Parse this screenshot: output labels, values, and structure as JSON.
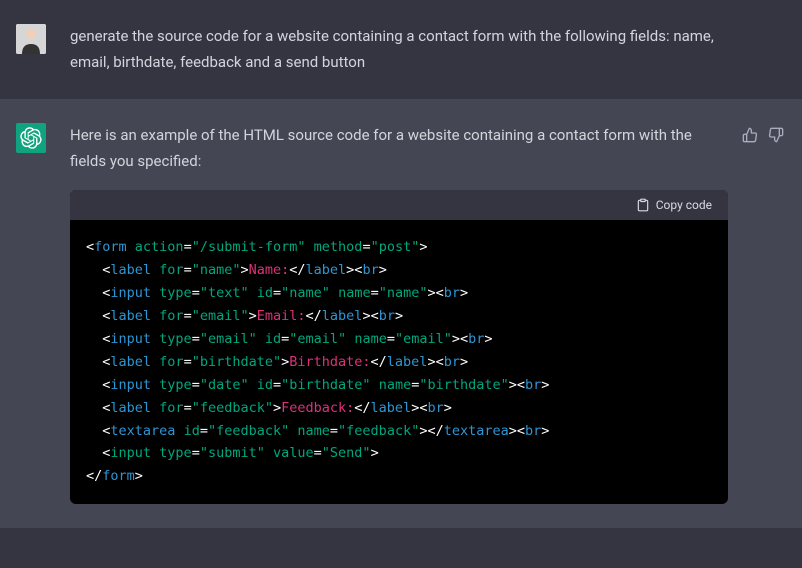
{
  "user": {
    "message": "generate the source code for a website containing a contact form with the following fields: name, email, birthdate, feedback and a send button"
  },
  "assistant": {
    "intro": "Here is an example of the HTML source code for a website containing a contact form with the fields you specified:",
    "copy_label": "Copy code",
    "code": {
      "tokens": [
        [
          {
            "t": "white",
            "v": "<"
          },
          {
            "t": "tag",
            "v": "form"
          },
          {
            "t": "white",
            "v": " "
          },
          {
            "t": "attr",
            "v": "action"
          },
          {
            "t": "white",
            "v": "="
          },
          {
            "t": "str",
            "v": "\"/submit-form\""
          },
          {
            "t": "white",
            "v": " "
          },
          {
            "t": "attr",
            "v": "method"
          },
          {
            "t": "white",
            "v": "="
          },
          {
            "t": "str",
            "v": "\"post\""
          },
          {
            "t": "white",
            "v": ">"
          }
        ],
        [
          {
            "t": "white",
            "v": "  <"
          },
          {
            "t": "tag",
            "v": "label"
          },
          {
            "t": "white",
            "v": " "
          },
          {
            "t": "attr",
            "v": "for"
          },
          {
            "t": "white",
            "v": "="
          },
          {
            "t": "str",
            "v": "\"name\""
          },
          {
            "t": "white",
            "v": ">"
          },
          {
            "t": "text",
            "v": "Name:"
          },
          {
            "t": "white",
            "v": "</"
          },
          {
            "t": "tag",
            "v": "label"
          },
          {
            "t": "white",
            "v": "><"
          },
          {
            "t": "tag",
            "v": "br"
          },
          {
            "t": "white",
            "v": ">"
          }
        ],
        [
          {
            "t": "white",
            "v": "  <"
          },
          {
            "t": "tag",
            "v": "input"
          },
          {
            "t": "white",
            "v": " "
          },
          {
            "t": "attr",
            "v": "type"
          },
          {
            "t": "white",
            "v": "="
          },
          {
            "t": "str",
            "v": "\"text\""
          },
          {
            "t": "white",
            "v": " "
          },
          {
            "t": "attr",
            "v": "id"
          },
          {
            "t": "white",
            "v": "="
          },
          {
            "t": "str",
            "v": "\"name\""
          },
          {
            "t": "white",
            "v": " "
          },
          {
            "t": "attr",
            "v": "name"
          },
          {
            "t": "white",
            "v": "="
          },
          {
            "t": "str",
            "v": "\"name\""
          },
          {
            "t": "white",
            "v": "><"
          },
          {
            "t": "tag",
            "v": "br"
          },
          {
            "t": "white",
            "v": ">"
          }
        ],
        [
          {
            "t": "white",
            "v": "  <"
          },
          {
            "t": "tag",
            "v": "label"
          },
          {
            "t": "white",
            "v": " "
          },
          {
            "t": "attr",
            "v": "for"
          },
          {
            "t": "white",
            "v": "="
          },
          {
            "t": "str",
            "v": "\"email\""
          },
          {
            "t": "white",
            "v": ">"
          },
          {
            "t": "text",
            "v": "Email:"
          },
          {
            "t": "white",
            "v": "</"
          },
          {
            "t": "tag",
            "v": "label"
          },
          {
            "t": "white",
            "v": "><"
          },
          {
            "t": "tag",
            "v": "br"
          },
          {
            "t": "white",
            "v": ">"
          }
        ],
        [
          {
            "t": "white",
            "v": "  <"
          },
          {
            "t": "tag",
            "v": "input"
          },
          {
            "t": "white",
            "v": " "
          },
          {
            "t": "attr",
            "v": "type"
          },
          {
            "t": "white",
            "v": "="
          },
          {
            "t": "str",
            "v": "\"email\""
          },
          {
            "t": "white",
            "v": " "
          },
          {
            "t": "attr",
            "v": "id"
          },
          {
            "t": "white",
            "v": "="
          },
          {
            "t": "str",
            "v": "\"email\""
          },
          {
            "t": "white",
            "v": " "
          },
          {
            "t": "attr",
            "v": "name"
          },
          {
            "t": "white",
            "v": "="
          },
          {
            "t": "str",
            "v": "\"email\""
          },
          {
            "t": "white",
            "v": "><"
          },
          {
            "t": "tag",
            "v": "br"
          },
          {
            "t": "white",
            "v": ">"
          }
        ],
        [
          {
            "t": "white",
            "v": "  <"
          },
          {
            "t": "tag",
            "v": "label"
          },
          {
            "t": "white",
            "v": " "
          },
          {
            "t": "attr",
            "v": "for"
          },
          {
            "t": "white",
            "v": "="
          },
          {
            "t": "str",
            "v": "\"birthdate\""
          },
          {
            "t": "white",
            "v": ">"
          },
          {
            "t": "text",
            "v": "Birthdate:"
          },
          {
            "t": "white",
            "v": "</"
          },
          {
            "t": "tag",
            "v": "label"
          },
          {
            "t": "white",
            "v": "><"
          },
          {
            "t": "tag",
            "v": "br"
          },
          {
            "t": "white",
            "v": ">"
          }
        ],
        [
          {
            "t": "white",
            "v": "  <"
          },
          {
            "t": "tag",
            "v": "input"
          },
          {
            "t": "white",
            "v": " "
          },
          {
            "t": "attr",
            "v": "type"
          },
          {
            "t": "white",
            "v": "="
          },
          {
            "t": "str",
            "v": "\"date\""
          },
          {
            "t": "white",
            "v": " "
          },
          {
            "t": "attr",
            "v": "id"
          },
          {
            "t": "white",
            "v": "="
          },
          {
            "t": "str",
            "v": "\"birthdate\""
          },
          {
            "t": "white",
            "v": " "
          },
          {
            "t": "attr",
            "v": "name"
          },
          {
            "t": "white",
            "v": "="
          },
          {
            "t": "str",
            "v": "\"birthdate\""
          },
          {
            "t": "white",
            "v": "><"
          },
          {
            "t": "tag",
            "v": "br"
          },
          {
            "t": "white",
            "v": ">"
          }
        ],
        [
          {
            "t": "white",
            "v": "  <"
          },
          {
            "t": "tag",
            "v": "label"
          },
          {
            "t": "white",
            "v": " "
          },
          {
            "t": "attr",
            "v": "for"
          },
          {
            "t": "white",
            "v": "="
          },
          {
            "t": "str",
            "v": "\"feedback\""
          },
          {
            "t": "white",
            "v": ">"
          },
          {
            "t": "text",
            "v": "Feedback:"
          },
          {
            "t": "white",
            "v": "</"
          },
          {
            "t": "tag",
            "v": "label"
          },
          {
            "t": "white",
            "v": "><"
          },
          {
            "t": "tag",
            "v": "br"
          },
          {
            "t": "white",
            "v": ">"
          }
        ],
        [
          {
            "t": "white",
            "v": "  <"
          },
          {
            "t": "tag",
            "v": "textarea"
          },
          {
            "t": "white",
            "v": " "
          },
          {
            "t": "attr",
            "v": "id"
          },
          {
            "t": "white",
            "v": "="
          },
          {
            "t": "str",
            "v": "\"feedback\""
          },
          {
            "t": "white",
            "v": " "
          },
          {
            "t": "attr",
            "v": "name"
          },
          {
            "t": "white",
            "v": "="
          },
          {
            "t": "str",
            "v": "\"feedback\""
          },
          {
            "t": "white",
            "v": "></"
          },
          {
            "t": "tag",
            "v": "textarea"
          },
          {
            "t": "white",
            "v": "><"
          },
          {
            "t": "tag",
            "v": "br"
          },
          {
            "t": "white",
            "v": ">"
          }
        ],
        [
          {
            "t": "white",
            "v": "  <"
          },
          {
            "t": "attr",
            "v": "input "
          },
          {
            "t": "attr",
            "v": "type"
          },
          {
            "t": "white",
            "v": "="
          },
          {
            "t": "str",
            "v": "\"submit\""
          },
          {
            "t": "white",
            "v": " "
          },
          {
            "t": "attr",
            "v": "value"
          },
          {
            "t": "white",
            "v": "="
          },
          {
            "t": "str",
            "v": "\"Send\""
          },
          {
            "t": "white",
            "v": ">"
          }
        ],
        [
          {
            "t": "white",
            "v": "</"
          },
          {
            "t": "tag",
            "v": "form"
          },
          {
            "t": "white",
            "v": ">"
          }
        ]
      ]
    }
  }
}
